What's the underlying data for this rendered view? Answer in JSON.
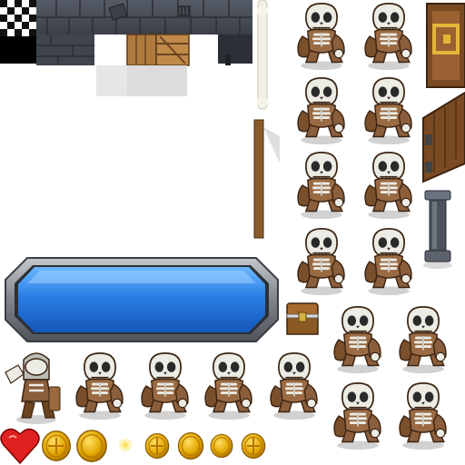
{
  "sprite_sheet": {
    "background": "#ffffff",
    "palette": {
      "dungeon_stone": "#4a4f5a",
      "dungeon_stone_dark": "#2c2f36",
      "wood": "#a8743a",
      "wood_dark": "#6b4520",
      "skeleton_bone": "#ecebe4",
      "skeleton_shadow": "#8e8e88",
      "skeleton_cloth": "#8b5e3c",
      "panel_blue": "#1f6ed8",
      "panel_blue_light": "#5aa9ff",
      "panel_frame": "#8f9499",
      "coin_gold": "#e0a500",
      "coin_dark": "#b87800",
      "heart_red": "#e02020",
      "pillar_gray": "#4b525a"
    },
    "tiles": [
      {
        "id": "checker-tile",
        "icon": "checkerboard-icon"
      },
      {
        "id": "stone-wall-tiles",
        "icon": "stone-wall-icon"
      },
      {
        "id": "wood-crates",
        "icon": "wooden-crate-icon"
      },
      {
        "id": "bone-staff",
        "icon": "bone-staff-icon"
      },
      {
        "id": "wooden-pole",
        "icon": "wooden-pole-icon"
      },
      {
        "id": "treasure-chest",
        "icon": "treasure-chest-icon"
      },
      {
        "id": "wooden-door-gold",
        "icon": "wooden-door-icon"
      },
      {
        "id": "wooden-door-plain",
        "icon": "wooden-door-icon"
      },
      {
        "id": "stone-pillar",
        "icon": "stone-pillar-icon"
      },
      {
        "id": "blue-panel",
        "icon": "blue-button-panel-icon"
      },
      {
        "id": "heart",
        "icon": "heart-icon"
      },
      {
        "id": "gold-coins",
        "icon": "coin-icon",
        "frames": 7
      }
    ],
    "skeleton_frames": {
      "right_column_pairs": 4,
      "lower_pairs": 2,
      "bottom_row": 5,
      "hooded_skeleton": 1
    }
  }
}
